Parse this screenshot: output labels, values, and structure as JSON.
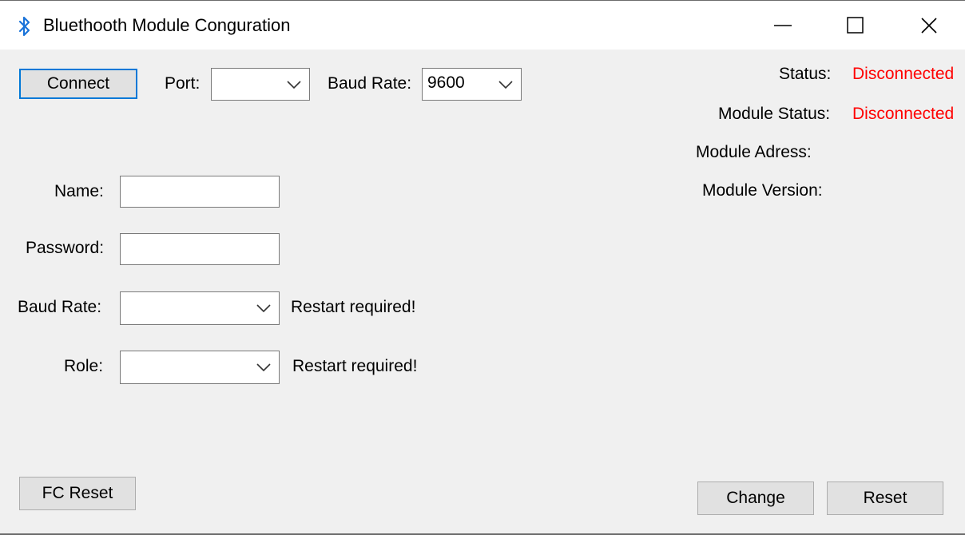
{
  "window": {
    "title": "Bluethooth Module Conguration",
    "icon": "bluetooth-icon",
    "controls": [
      "minimize-icon",
      "maximize-icon",
      "close-icon"
    ]
  },
  "connection": {
    "connect_label": "Connect",
    "port_label": "Port:",
    "port_value": "",
    "baud_label": "Baud Rate:",
    "baud_value": "9600"
  },
  "status": {
    "status_label": "Status:",
    "status_value": "Disconnected",
    "module_status_label": "Module Status:",
    "module_status_value": "Disconnected",
    "module_address_label": "Module Adress:",
    "module_version_label": "Module Version:",
    "value_color": "#ff0000"
  },
  "form": {
    "name_label": "Name:",
    "name_value": "",
    "password_label": "Password:",
    "password_value": "",
    "baud_label": "Baud Rate:",
    "baud_value": "",
    "baud_note": "Restart required!",
    "role_label": "Role:",
    "role_value": "",
    "role_note": "Restart required!"
  },
  "actions": {
    "fc_reset_label": "FC Reset",
    "change_label": "Change",
    "reset_label": "Reset"
  }
}
